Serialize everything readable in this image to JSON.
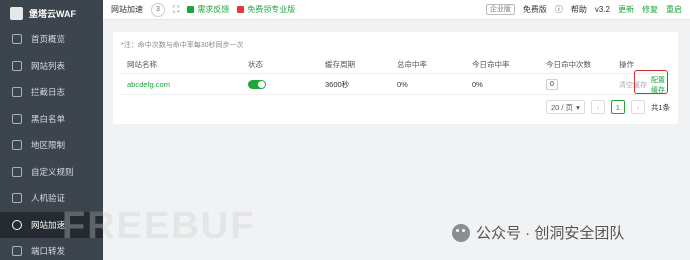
{
  "app": {
    "brand": "堡塔云WAF"
  },
  "sidebar": {
    "items": [
      {
        "label": "首页概览"
      },
      {
        "label": "网站列表"
      },
      {
        "label": "拦截日志"
      },
      {
        "label": "黑白名单"
      },
      {
        "label": "地区限制"
      },
      {
        "label": "自定义规则"
      },
      {
        "label": "人机验证"
      },
      {
        "label": "网站加速",
        "active": true
      },
      {
        "label": "端口转发"
      }
    ]
  },
  "topbar": {
    "title": "网站加速",
    "count": "3",
    "feedback": "需求反馈",
    "pro": "免费领专业版",
    "enterprise_badge": "企业版",
    "edition": "免费版",
    "help": "帮助",
    "version": "v3.2",
    "update": "更新",
    "repair": "修复",
    "restart": "重启"
  },
  "panel": {
    "note": "*注：命中次数与命中率每30秒同步一次",
    "columns": [
      "网站名称",
      "状态",
      "缓存周期",
      "总命中率",
      "今日命中率",
      "今日命中次数",
      "操作"
    ],
    "rows": [
      {
        "site": "abcdefg.com",
        "status_on": true,
        "cache_period": "3600秒",
        "total_hit_rate": "0%",
        "today_hit_rate": "0%",
        "today_hits": "0",
        "op_clear": "清空缓存",
        "op_config": "配置缓存"
      }
    ]
  },
  "pagination": {
    "page_size": "20 / 页",
    "current_page": "1",
    "total": "共1条"
  },
  "watermarks": {
    "freebuf": "FREEBUF",
    "wechat": "公众号 · 创洞安全团队"
  },
  "colors": {
    "accent": "#20a53a",
    "sidebar_bg": "#3c444d",
    "highlight": "#d32f2f"
  }
}
